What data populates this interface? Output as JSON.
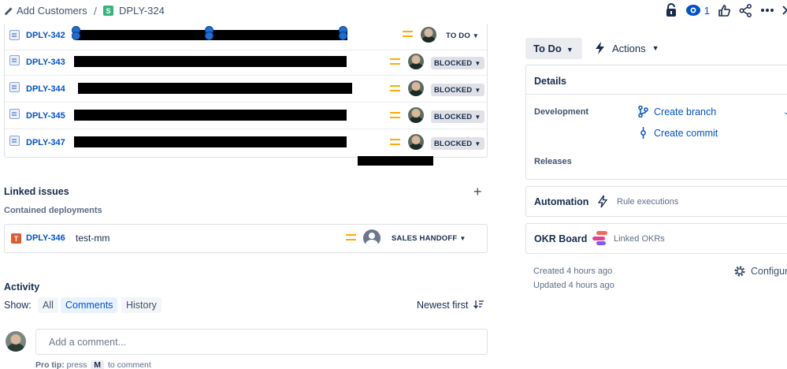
{
  "breadcrumb": {
    "parent": "Add Customers",
    "separator": "/",
    "current": "DPLY-324",
    "current_icon_letter": "S"
  },
  "top_actions": {
    "watch_count": "1"
  },
  "child_issues": [
    {
      "key": "DPLY-342",
      "status": "TO DO"
    },
    {
      "key": "DPLY-343",
      "status": "BLOCKED"
    },
    {
      "key": "DPLY-344",
      "status": "BLOCKED"
    },
    {
      "key": "DPLY-345",
      "status": "BLOCKED"
    },
    {
      "key": "DPLY-347",
      "status": "BLOCKED"
    }
  ],
  "linked_issues": {
    "title": "Linked issues",
    "subtitle": "Contained deployments",
    "items": [
      {
        "key": "DPLY-346",
        "summary": "test-mm",
        "status": "SALES HANDOFF",
        "type_icon_letter": "T"
      }
    ]
  },
  "activity": {
    "title": "Activity",
    "show_label": "Show:",
    "filters": [
      "All",
      "Comments",
      "History"
    ],
    "active_filter": "Comments",
    "sort_label": "Newest first",
    "comment_placeholder": "Add a comment...",
    "protip_prefix": "Pro tip:",
    "protip_press": "press",
    "protip_key": "M",
    "protip_suffix": "to comment"
  },
  "right_panel": {
    "status_button": "To Do",
    "actions_label": "Actions",
    "details": {
      "title": "Details",
      "development_label": "Development",
      "create_branch": "Create branch",
      "create_commit": "Create commit",
      "releases_label": "Releases"
    },
    "automation": {
      "title": "Automation",
      "link": "Rule executions"
    },
    "okr": {
      "title": "OKR Board",
      "link": "Linked OKRs"
    },
    "created": "Created 4 hours ago",
    "updated": "Updated 4 hours ago",
    "configure": "Configure"
  },
  "colors": {
    "link": "#0052cc",
    "priority_medium": "#ffab00",
    "story": "#36b37e",
    "test": "#e05a2f"
  }
}
